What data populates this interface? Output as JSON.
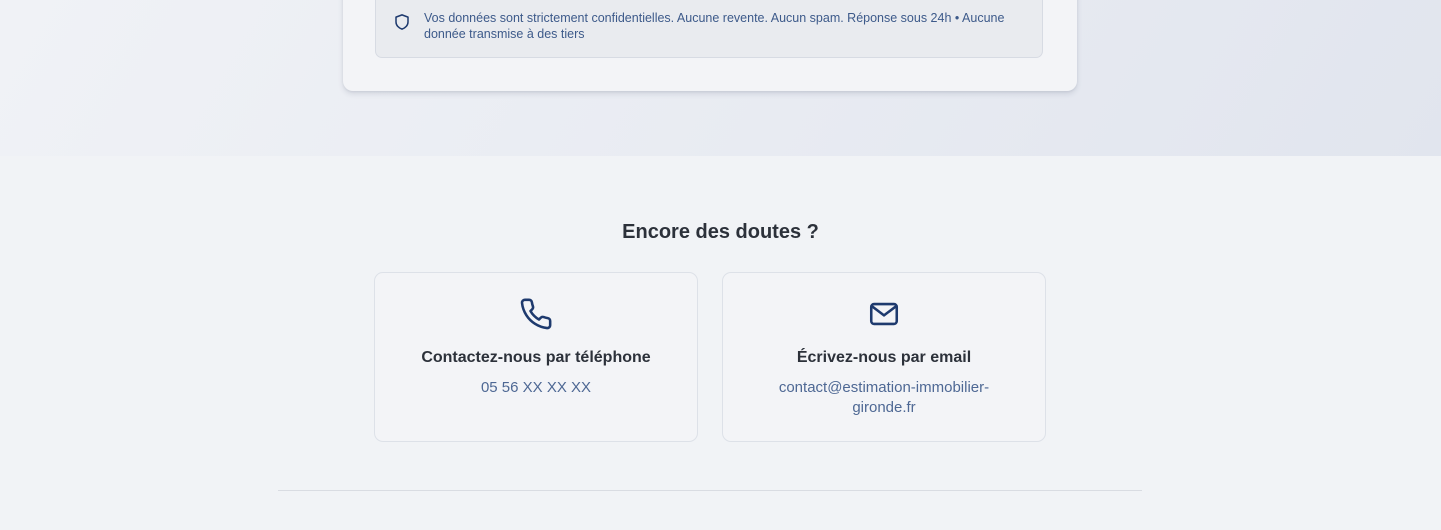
{
  "privacy": {
    "icon": "shield-icon",
    "text": "Vos données sont strictement confidentielles. Aucune revente. Aucun spam. Réponse sous 24h • Aucune donnée transmise à des tiers"
  },
  "contact": {
    "title": "Encore des doutes ?",
    "phone": {
      "icon": "phone-icon",
      "title": "Contactez-nous par téléphone",
      "value": "05 56 XX XX XX"
    },
    "email": {
      "icon": "mail-icon",
      "title": "Écrivez-nous par email",
      "value": "contact@estimation-immobilier-gironde.fr"
    }
  },
  "colors": {
    "accent": "#1e3a6e",
    "text_dark": "#2c313a",
    "text_muted": "#4e6894"
  }
}
